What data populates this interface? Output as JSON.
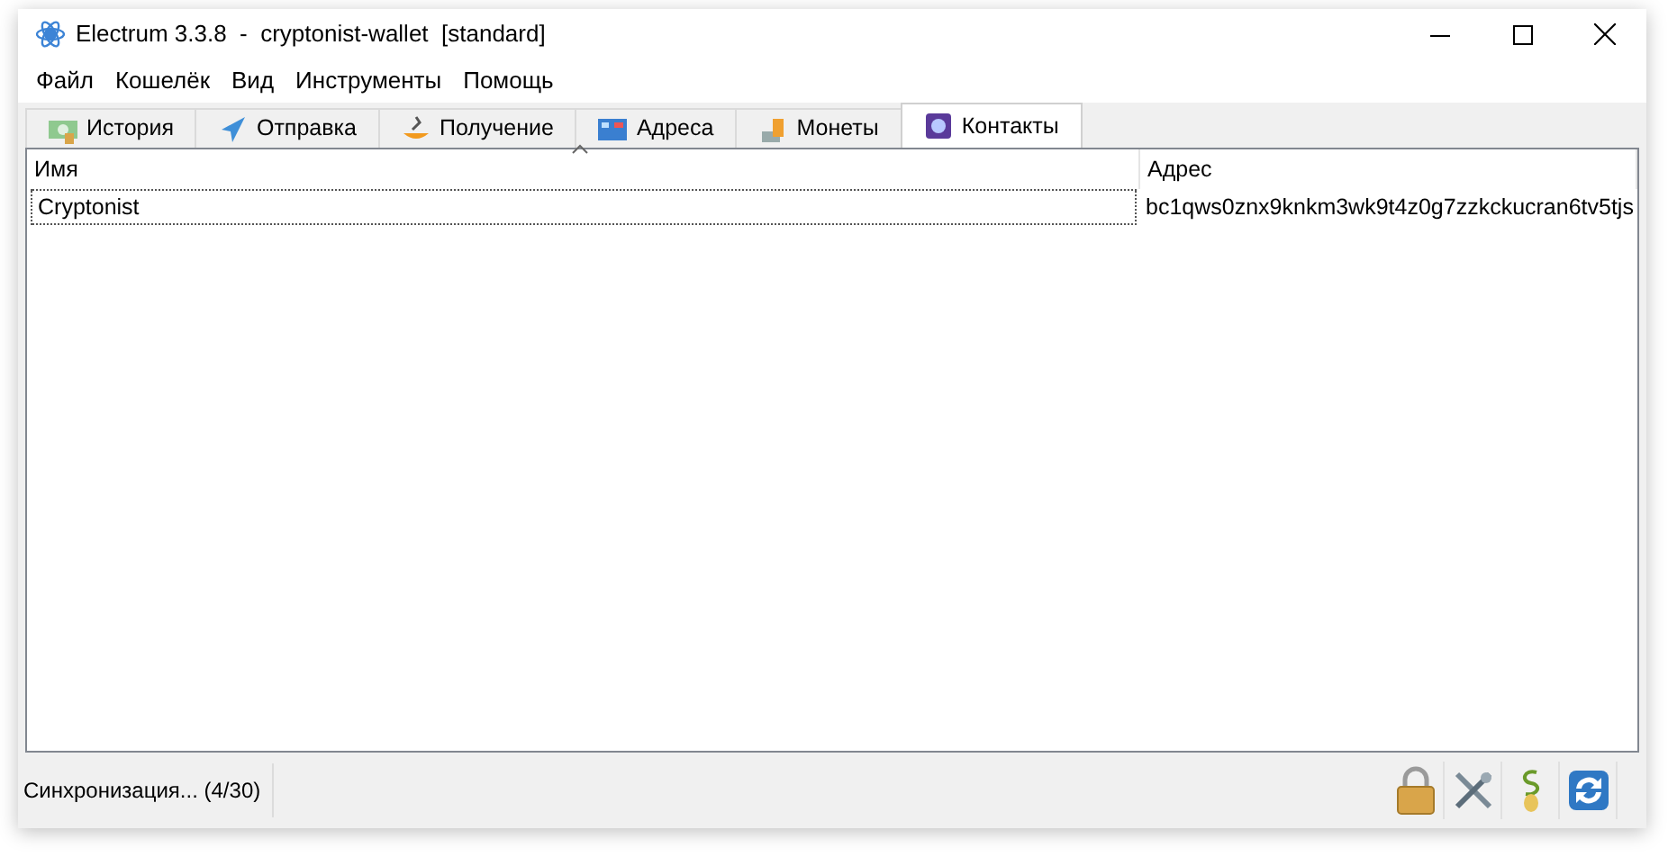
{
  "window": {
    "title": "Electrum 3.3.8  -  cryptonist-wallet  [standard]"
  },
  "menu": [
    "Файл",
    "Кошелёк",
    "Вид",
    "Инструменты",
    "Помощь"
  ],
  "tabs": [
    {
      "label": "История",
      "kind": "history",
      "selected": false
    },
    {
      "label": "Отправка",
      "kind": "send",
      "selected": false
    },
    {
      "label": "Получение",
      "kind": "receive",
      "selected": false
    },
    {
      "label": "Адреса",
      "kind": "addresses",
      "selected": false
    },
    {
      "label": "Монеты",
      "kind": "coins",
      "selected": false
    },
    {
      "label": "Контакты",
      "kind": "contacts",
      "selected": true
    }
  ],
  "table": {
    "columns": [
      "Имя",
      "Адрес"
    ],
    "rows": [
      {
        "cells": [
          "Cryptonist",
          "bc1qws0znx9knkm3wk9t4z0g7zzkckucran6tv5tjs"
        ],
        "selected": true
      }
    ]
  },
  "status_bar": {
    "text": "Синхронизация... (4/30)"
  }
}
